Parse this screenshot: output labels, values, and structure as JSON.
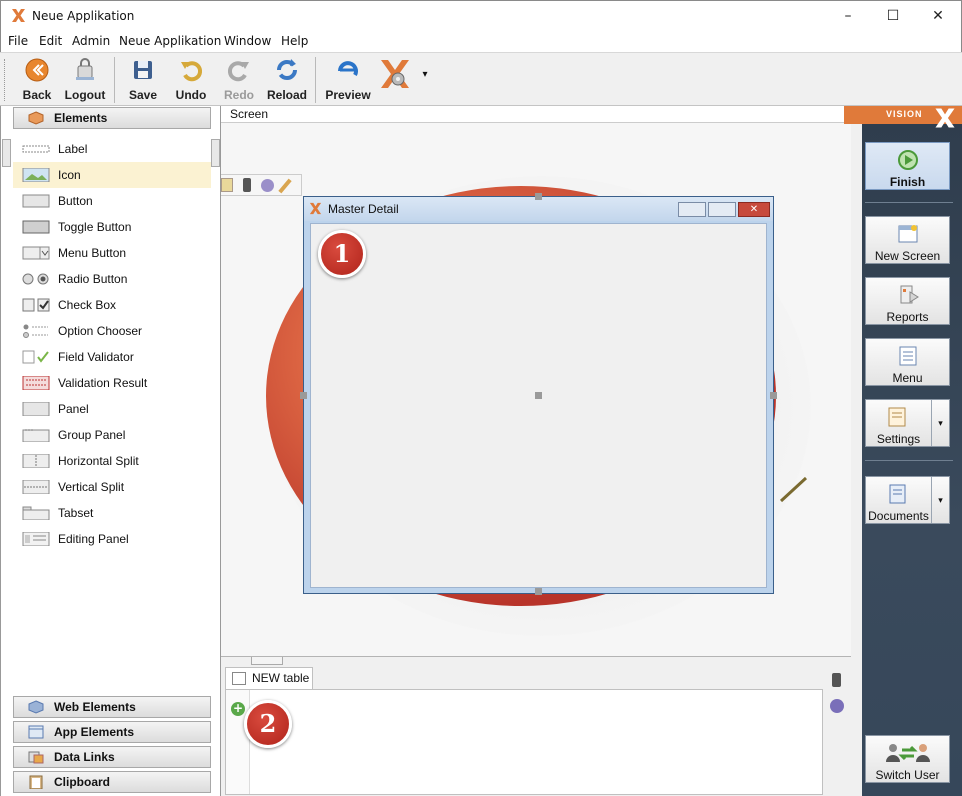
{
  "window": {
    "title": "Neue Applikation",
    "minimize": "–",
    "maximize": "☐",
    "close": "✕"
  },
  "menu": [
    "File",
    "Edit",
    "Admin",
    "Neue Applikation",
    "Window",
    "Help"
  ],
  "toolbar": {
    "back": "Back",
    "logout": "Logout",
    "save": "Save",
    "undo": "Undo",
    "redo": "Redo",
    "reload": "Reload",
    "preview": "Preview",
    "dropdown": "▾"
  },
  "left_panel": {
    "header": "Elements",
    "items": [
      {
        "label": "Label",
        "icon": "label-icon"
      },
      {
        "label": "Icon",
        "icon": "image-icon",
        "selected": true
      },
      {
        "label": "Button",
        "icon": "button-icon"
      },
      {
        "label": "Toggle Button",
        "icon": "toggle-button-icon"
      },
      {
        "label": "Menu Button",
        "icon": "menu-button-icon"
      },
      {
        "label": "Radio Button",
        "icon": "radio-button-icon"
      },
      {
        "label": "Check Box",
        "icon": "check-box-icon"
      },
      {
        "label": "Option Chooser",
        "icon": "option-chooser-icon"
      },
      {
        "label": "Field Validator",
        "icon": "field-validator-icon"
      },
      {
        "label": "Validation Result",
        "icon": "validation-result-icon"
      },
      {
        "label": "Panel",
        "icon": "panel-icon"
      },
      {
        "label": "Group Panel",
        "icon": "group-panel-icon"
      },
      {
        "label": "Horizontal Split",
        "icon": "horizontal-split-icon"
      },
      {
        "label": "Vertical Split",
        "icon": "vertical-split-icon"
      },
      {
        "label": "Tabset",
        "icon": "tabset-icon"
      },
      {
        "label": "Editing Panel",
        "icon": "editing-panel-icon"
      }
    ],
    "sections": [
      "Web Elements",
      "App Elements",
      "Data Links",
      "Clipboard"
    ]
  },
  "canvas": {
    "breadcrumb": "Screen",
    "dialog_title": "Master Detail",
    "badge_1": "1",
    "badge_2": "2"
  },
  "bottom": {
    "tab_label": "NEW table"
  },
  "right_panel": {
    "brand": "VISION",
    "finish": "Finish",
    "new_screen": "New Screen",
    "reports": "Reports",
    "menu": "Menu",
    "settings": "Settings",
    "documents": "Documents",
    "switch_user": "Switch User"
  },
  "colors": {
    "accent": "#e07a3a",
    "selected_row": "#fbf2d2",
    "dark_panel": "#34404e",
    "badge": "#c0302a"
  }
}
